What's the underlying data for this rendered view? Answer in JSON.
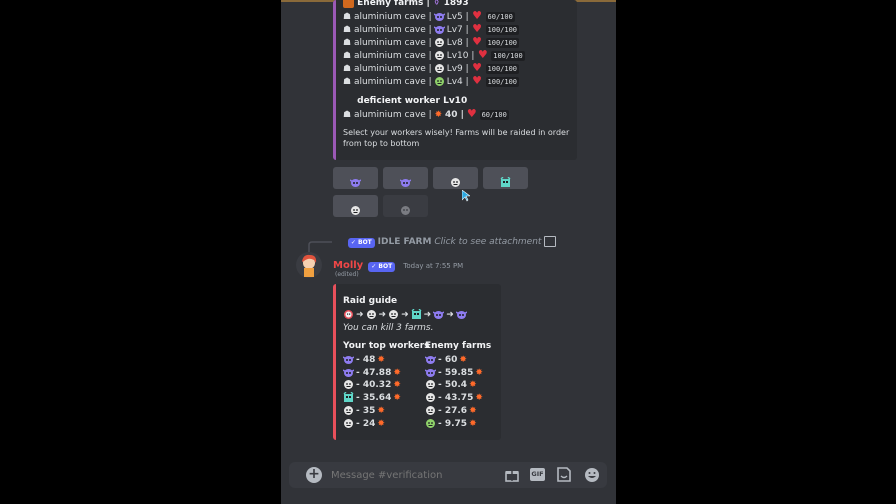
{
  "colors": {
    "bg": "#313338",
    "embed": "#2b2d31",
    "bar_purple": "#9b59b6",
    "bar_red": "#e8505b",
    "accent": "#5865f2",
    "username": "#f04747"
  },
  "enemy_embed": {
    "heading": "Enemy farms |",
    "coins": "1893",
    "rows": [
      {
        "farm": "aluminium cave |",
        "icon": "purple-goblin-icon",
        "level": "Lv5 |",
        "hp": "60/100"
      },
      {
        "farm": "aluminium cave |",
        "icon": "purple-goblin-icon",
        "level": "Lv7 |",
        "hp": "100/100"
      },
      {
        "farm": "aluminium cave |",
        "icon": "face-icon",
        "level": "Lv8 |",
        "hp": "100/100"
      },
      {
        "farm": "aluminium cave |",
        "icon": "face-icon",
        "level": "Lv10 |",
        "hp": "100/100"
      },
      {
        "farm": "aluminium cave |",
        "icon": "face-icon",
        "level": "Lv9 |",
        "hp": "100/100"
      },
      {
        "farm": "aluminium cave |",
        "icon": "green-face-icon",
        "level": "Lv4 |",
        "hp": "100/100"
      }
    ],
    "worker_title": "deficient worker Lv10",
    "worker_row": {
      "farm": "aluminium cave |",
      "power": "40 |",
      "hp": "60/100"
    },
    "note_line1": "Select your workers wisely! Farms will be raided in order",
    "note_line2": "from top to bottom"
  },
  "buttons": [
    "purple-goblin-icon",
    "purple-goblin-icon",
    "face-icon",
    "cyan-robot-icon",
    "face-icon",
    "faint-face-icon"
  ],
  "reply": {
    "badge": "✓ BOT",
    "name": "IDLE FARM",
    "text": "Click to see attachment"
  },
  "message": {
    "username": "Molly",
    "badge": "✓ BOT",
    "time": "Today at 7:55 PM",
    "edited": "(edited)"
  },
  "raid_embed": {
    "title": "Raid guide",
    "order_icons": [
      "skull-icon",
      "face-icon",
      "face-icon",
      "cyan-robot-icon",
      "purple-goblin-icon",
      "purple-goblin-icon"
    ],
    "kill_text": "You can kill 3 farms.",
    "col1_title": "Your top workers",
    "col2_title": "Enemy farms",
    "workers": [
      {
        "icon": "purple-goblin-icon",
        "value": "- 48"
      },
      {
        "icon": "purple-goblin-icon",
        "value": "- 47.88"
      },
      {
        "icon": "face-icon",
        "value": "- 40.32"
      },
      {
        "icon": "cyan-robot-icon",
        "value": "- 35.64"
      },
      {
        "icon": "face-icon",
        "value": "- 35"
      },
      {
        "icon": "face-icon",
        "value": "- 24"
      }
    ],
    "enemies": [
      {
        "icon": "purple-goblin-icon",
        "value": "- 60"
      },
      {
        "icon": "purple-goblin-icon",
        "value": "- 59.85"
      },
      {
        "icon": "face-icon",
        "value": "- 50.4"
      },
      {
        "icon": "face-icon",
        "value": "- 43.75"
      },
      {
        "icon": "face-icon",
        "value": "- 27.6"
      },
      {
        "icon": "green-face-icon",
        "value": "- 9.75"
      }
    ]
  },
  "composer": {
    "placeholder": "Message #verification",
    "gif": "GIF"
  }
}
